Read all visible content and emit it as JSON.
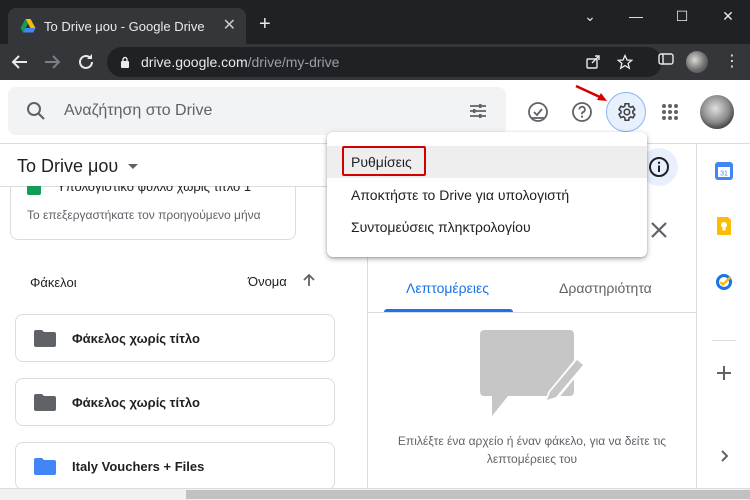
{
  "browser": {
    "tab_title": "Το Drive μου - Google Drive",
    "new_tab_label": "+",
    "window_controls": {
      "minimize": "—",
      "maximize": "☐",
      "close": "✕",
      "list": "⌄"
    },
    "url_host": "drive.google.com",
    "url_path": "/drive/my-drive"
  },
  "drive_header": {
    "search_placeholder": "Αναζήτηση στο Drive"
  },
  "main": {
    "title": "Το Drive μου",
    "recent_file": {
      "title": "Υπολογιστικό φύλλο χωρίς τίτλο 1",
      "subtitle": "Το επεξεργαστήκατε τον προηγούμενο μήνα"
    },
    "folders_section": "Φάκελοι",
    "sort_label": "Όνομα",
    "folders": [
      {
        "name": "Φάκελος χωρίς τίτλο",
        "color": "#5f6368"
      },
      {
        "name": "Φάκελος χωρίς τίτλο",
        "color": "#5f6368"
      },
      {
        "name": "Italy Vouchers + Files",
        "color": "#4285f4"
      }
    ]
  },
  "details": {
    "tabs": [
      "Λεπτομέρειες",
      "Δραστηριότητα"
    ],
    "active_tab": 0,
    "empty_text": "Επιλέξτε ένα αρχείο ή έναν φάκελο, για να δείτε τις λεπτομέρειες του"
  },
  "settings_menu": {
    "items": [
      "Ρυθμίσεις",
      "Αποκτήστε το Drive για υπολογιστή",
      "Συντομεύσεις πληκτρολογίου"
    ],
    "highlighted_index": 0
  },
  "colors": {
    "accent": "#1a73e8",
    "annotation": "#d40000"
  }
}
